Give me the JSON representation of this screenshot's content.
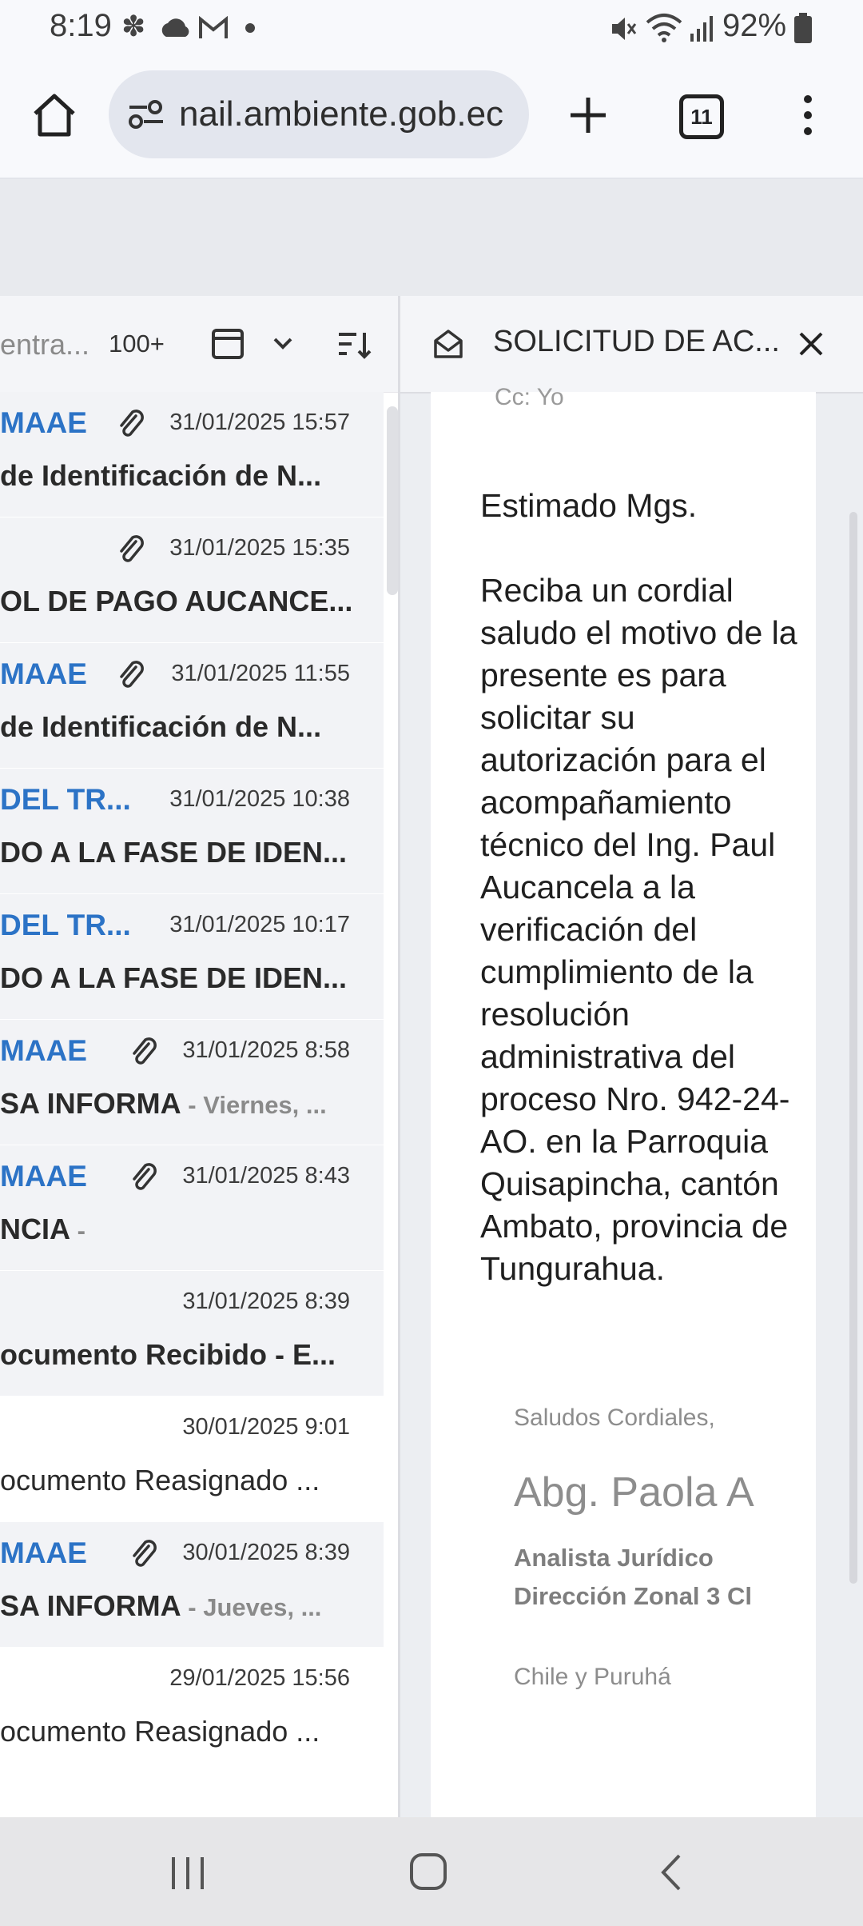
{
  "status_bar": {
    "time": "8:19",
    "battery": "92%",
    "icons": [
      "pinwheel-icon",
      "cloud-icon",
      "gmail-icon",
      "dot-icon",
      "mute-icon",
      "wifi-icon",
      "signal-icon",
      "battery-icon"
    ]
  },
  "browser": {
    "url": "nail.ambiente.gob.ec",
    "tab_count": "11",
    "icons": [
      "home-icon",
      "site-settings-icon",
      "new-tab-icon",
      "tab-switcher-icon",
      "more-menu-icon"
    ]
  },
  "list_toolbar": {
    "folder_label": "entra...",
    "count": "100+"
  },
  "messages": [
    {
      "sender": "MAAE",
      "attachment": true,
      "date": "31/01/2025 15:57",
      "subject": "de Identificación de N...",
      "preview": "",
      "unread": true
    },
    {
      "sender": "",
      "attachment": true,
      "date": "31/01/2025 15:35",
      "subject": "OL DE PAGO AUCANCE...",
      "preview": "",
      "unread": true
    },
    {
      "sender": "MAAE",
      "attachment": true,
      "date": "31/01/2025 11:55",
      "subject": "de Identificación de N...",
      "preview": "",
      "unread": true
    },
    {
      "sender": "DEL TR...",
      "attachment": false,
      "date": "31/01/2025 10:38",
      "subject": "DO A LA FASE DE IDEN...",
      "preview": "",
      "unread": true
    },
    {
      "sender": "DEL TR...",
      "attachment": false,
      "date": "31/01/2025 10:17",
      "subject": "DO A LA FASE DE IDEN...",
      "preview": "",
      "unread": true
    },
    {
      "sender": "MAAE",
      "attachment": true,
      "date": "31/01/2025 8:58",
      "subject": "SA INFORMA",
      "preview": "Viernes, ...",
      "unread": true
    },
    {
      "sender": "MAAE",
      "attachment": true,
      "date": "31/01/2025 8:43",
      "subject": "NCIA",
      "preview": "",
      "unread": true
    },
    {
      "sender": "",
      "attachment": false,
      "date": "31/01/2025 8:39",
      "subject": "ocumento Recibido - E...",
      "preview": "",
      "unread": true
    },
    {
      "sender": "",
      "attachment": false,
      "date": "30/01/2025 9:01",
      "subject": "ocumento Reasignado ...",
      "preview": "",
      "unread": false
    },
    {
      "sender": "MAAE",
      "attachment": true,
      "date": "30/01/2025 8:39",
      "subject": "SA INFORMA",
      "preview": "Jueves, ...",
      "unread": true
    },
    {
      "sender": "",
      "attachment": false,
      "date": "29/01/2025 15:56",
      "subject": "ocumento Reasignado ...",
      "preview": "",
      "unread": false
    }
  ],
  "reader": {
    "title": "SOLICITUD DE AC...",
    "cc_line": "Cc: Yo",
    "greeting": "Estimado Mgs.",
    "body": "Reciba un cordial saludo el motivo de la presente es para solicitar su autorización para el acompañamiento técnico del Ing. Paul Aucancela a la verificación del cumplimiento de la resolución administrativa del proceso Nro. 942-24-AO. en la Parroquia Quisapincha, cantón Ambato, provincia de Tungurahua.",
    "signature": {
      "closing": "Saludos Cordiales,",
      "name": "Abg. Paola A",
      "role": "Analista Jurídico",
      "office": "Dirección Zonal 3 Cl",
      "address": "Chile y Puruhá"
    }
  },
  "nav": {
    "icons": [
      "recents-icon",
      "home-button-icon",
      "back-icon"
    ]
  }
}
